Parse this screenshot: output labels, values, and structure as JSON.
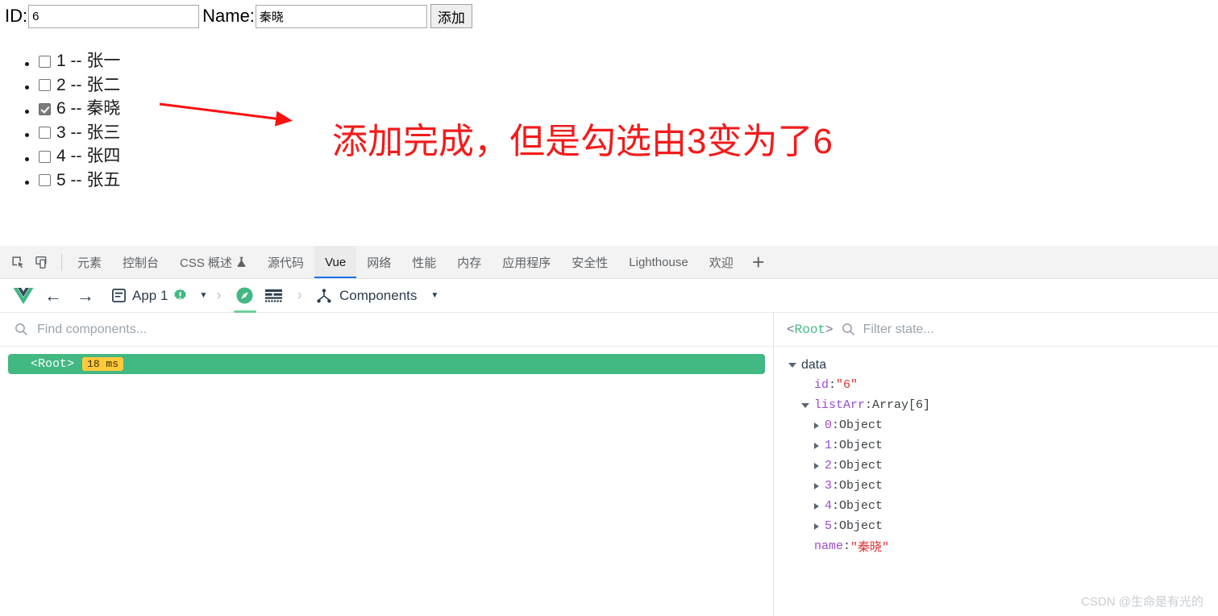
{
  "app": {
    "form": {
      "id_label": "ID:",
      "id_value": "6",
      "name_label": "Name:",
      "name_value": "秦晓",
      "add_button": "添加"
    },
    "list": [
      {
        "checked": false,
        "text": "1 -- 张一"
      },
      {
        "checked": false,
        "text": "2 -- 张二"
      },
      {
        "checked": true,
        "text": "6 -- 秦晓"
      },
      {
        "checked": false,
        "text": "3 -- 张三"
      },
      {
        "checked": false,
        "text": "4 -- 张四"
      },
      {
        "checked": false,
        "text": "5 -- 张五"
      }
    ],
    "annotation": {
      "text": "添加完成，但是勾选由3变为了6",
      "color": "#f31b1b"
    }
  },
  "devtools": {
    "tabs": [
      {
        "label": "元素",
        "active": false
      },
      {
        "label": "控制台",
        "active": false
      },
      {
        "label": "CSS 概述",
        "active": false,
        "icon": "flask-icon"
      },
      {
        "label": "源代码",
        "active": false
      },
      {
        "label": "Vue",
        "active": true
      },
      {
        "label": "网络",
        "active": false
      },
      {
        "label": "性能",
        "active": false
      },
      {
        "label": "内存",
        "active": false
      },
      {
        "label": "应用程序",
        "active": false
      },
      {
        "label": "安全性",
        "active": false
      },
      {
        "label": "Lighthouse",
        "active": false
      },
      {
        "label": "欢迎",
        "active": false
      }
    ],
    "add_tab_label": "+",
    "vue_toolbar": {
      "app_name": "App 1",
      "panel_name": "Components"
    },
    "components_panel": {
      "search_placeholder": "Find components...",
      "tree": [
        {
          "name": "<Root>",
          "time": "18 ms",
          "selected": true
        }
      ]
    },
    "state_panel": {
      "component": "<Root>",
      "filter_placeholder": "Filter state...",
      "section": "data",
      "entries": [
        {
          "level": 1,
          "key": "id",
          "value": "\"6\"",
          "kind": "string",
          "expandable": false
        },
        {
          "level": 1,
          "key": "listArr",
          "value": "Array[6]",
          "kind": "type",
          "expandable": true,
          "expanded": true
        },
        {
          "level": 2,
          "key": "0",
          "value": "Object",
          "kind": "type",
          "expandable": true,
          "expanded": false
        },
        {
          "level": 2,
          "key": "1",
          "value": "Object",
          "kind": "type",
          "expandable": true,
          "expanded": false
        },
        {
          "level": 2,
          "key": "2",
          "value": "Object",
          "kind": "type",
          "expandable": true,
          "expanded": false
        },
        {
          "level": 2,
          "key": "3",
          "value": "Object",
          "kind": "type",
          "expandable": true,
          "expanded": false
        },
        {
          "level": 2,
          "key": "4",
          "value": "Object",
          "kind": "type",
          "expandable": true,
          "expanded": false
        },
        {
          "level": 2,
          "key": "5",
          "value": "Object",
          "kind": "type",
          "expandable": true,
          "expanded": false
        },
        {
          "level": 1,
          "key": "name",
          "value": "\"秦晓\"",
          "kind": "string",
          "expandable": false
        }
      ]
    }
  },
  "watermark": "CSDN @生命是有光的"
}
